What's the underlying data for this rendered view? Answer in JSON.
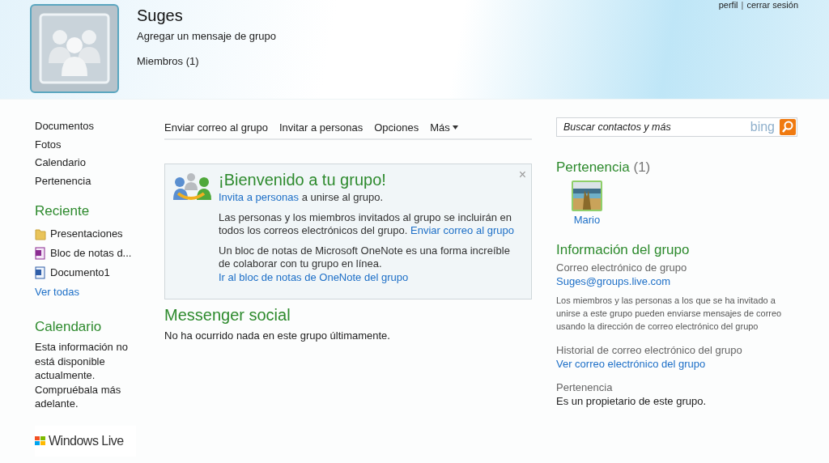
{
  "header": {
    "title": "Suges",
    "message": "Agregar un mensaje de grupo",
    "members": "Miembros (1)",
    "top_links": [
      "perfil",
      "cerrar sesión"
    ],
    "separator": "|"
  },
  "sidebar": {
    "items": [
      "Documentos",
      "Fotos",
      "Calendario",
      "Pertenencia"
    ],
    "recent": {
      "title": "Reciente",
      "items": [
        {
          "kind": "folder",
          "label": "Presentaciones"
        },
        {
          "kind": "onenote",
          "label": "Bloc de notas d..."
        },
        {
          "kind": "word",
          "label": "Documento1"
        }
      ],
      "see_all": "Ver todas"
    },
    "calendar": {
      "title": "Calendario",
      "text": "Esta información no está disponible actualmente. Compruébala más adelante."
    },
    "logo": "Windows Live"
  },
  "toolbar": {
    "items": [
      {
        "label": "Enviar correo al grupo",
        "dropdown": false
      },
      {
        "label": "Invitar a personas",
        "dropdown": false
      },
      {
        "label": "Opciones",
        "dropdown": false
      },
      {
        "label": "Más",
        "dropdown": true
      }
    ]
  },
  "welcome": {
    "title": "¡Bienvenido a tu grupo!",
    "close": "×",
    "paragraphs": [
      [
        {
          "kind": "link",
          "text": "Invita a personas"
        },
        {
          "kind": "text",
          "text": " a unirse al grupo."
        }
      ],
      [
        {
          "kind": "text",
          "text": "Las personas y los miembros invitados al grupo se incluirán en todos los correos electrónicos del grupo. "
        },
        {
          "kind": "link",
          "text": "Enviar correo al grupo"
        }
      ],
      [
        {
          "kind": "text",
          "text": "Un bloc de notas de Microsoft OneNote es una forma increíble de colaborar con tu grupo en línea. "
        },
        {
          "kind": "link",
          "text": "Ir al bloc de notas de OneNote del grupo"
        }
      ]
    ]
  },
  "social": {
    "title": "Messenger social",
    "text": "No ha ocurrido nada en este grupo últimamente."
  },
  "search": {
    "placeholder": "Buscar contactos y más",
    "logo": "bing"
  },
  "membership": {
    "title": "Pertenencia",
    "count": "(1)",
    "members": [
      {
        "name": "Mario"
      }
    ]
  },
  "info": {
    "title": "Información del grupo",
    "sections": [
      {
        "label": "Correo electrónico de grupo",
        "value": "Suges@groups.live.com",
        "kind": "link",
        "note": "Los miembros y las personas a los que se ha invitado a unirse a este grupo pueden enviarse mensajes de correo usando la dirección de correo electrónico del grupo"
      },
      {
        "label": "Historial de correo electrónico del grupo",
        "value": "Ver correo electrónico del grupo",
        "kind": "link"
      },
      {
        "label": "Pertenencia",
        "value": "Es un propietario de este grupo.",
        "kind": "text"
      }
    ]
  }
}
